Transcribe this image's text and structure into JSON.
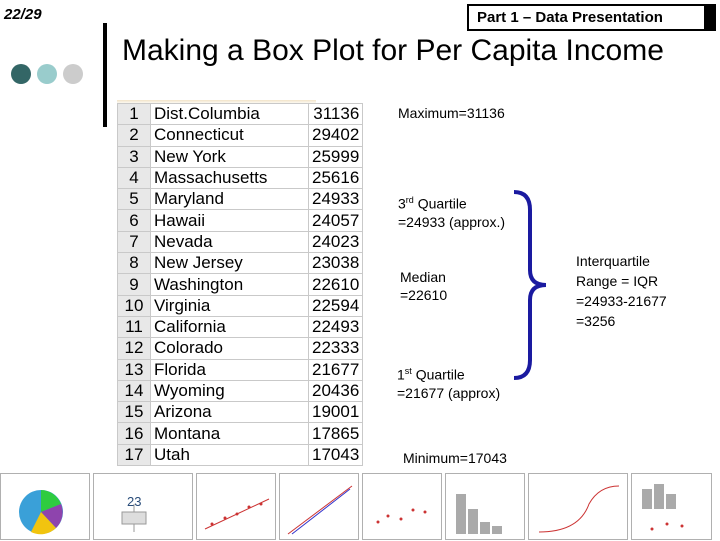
{
  "slide_number": "22/29",
  "section_title": "Part 1 – Data Presentation",
  "title": "Making a Box Plot for Per Capita Income",
  "dots": [
    "#336666",
    "#99cccc",
    "#cccccc"
  ],
  "table": [
    {
      "rank": "1",
      "state": "Dist.Columbia",
      "income": "31136"
    },
    {
      "rank": "2",
      "state": "Connecticut",
      "income": "29402"
    },
    {
      "rank": "3",
      "state": "New York",
      "income": "25999"
    },
    {
      "rank": "4",
      "state": "Massachusetts",
      "income": "25616"
    },
    {
      "rank": "5",
      "state": "Maryland",
      "income": "24933"
    },
    {
      "rank": "6",
      "state": "Hawaii",
      "income": "24057"
    },
    {
      "rank": "7",
      "state": "Nevada",
      "income": "24023"
    },
    {
      "rank": "8",
      "state": "New Jersey",
      "income": "23038"
    },
    {
      "rank": "9",
      "state": "Washington",
      "income": "22610"
    },
    {
      "rank": "10",
      "state": "Virginia",
      "income": "22594"
    },
    {
      "rank": "11",
      "state": "California",
      "income": "22493"
    },
    {
      "rank": "12",
      "state": "Colorado",
      "income": "22333"
    },
    {
      "rank": "13",
      "state": "Florida",
      "income": "21677"
    },
    {
      "rank": "14",
      "state": "Wyoming",
      "income": "20436"
    },
    {
      "rank": "15",
      "state": "Arizona",
      "income": "19001"
    },
    {
      "rank": "16",
      "state": "Montana",
      "income": "17865"
    },
    {
      "rank": "17",
      "state": "Utah",
      "income": "17043"
    }
  ],
  "annotations": {
    "maximum": "Maximum=31136",
    "q3_prefix": "3",
    "q3_sup": "rd",
    "q3_suffix": " Quartile",
    "q3_value": "=24933 (approx.)",
    "median_label": "Median",
    "median_value": "=22610",
    "q1_prefix": "1",
    "q1_sup": "st",
    "q1_suffix": " Quartile",
    "q1_value": "=21677 (approx)",
    "minimum": "Minimum=17043",
    "iqr_line1": "Interquartile",
    "iqr_line2": "Range = IQR",
    "iqr_line3": "=24933-21677",
    "iqr_line4": "=3256"
  },
  "brace_color": "#1a1aa0",
  "thumbnail_label": "23"
}
